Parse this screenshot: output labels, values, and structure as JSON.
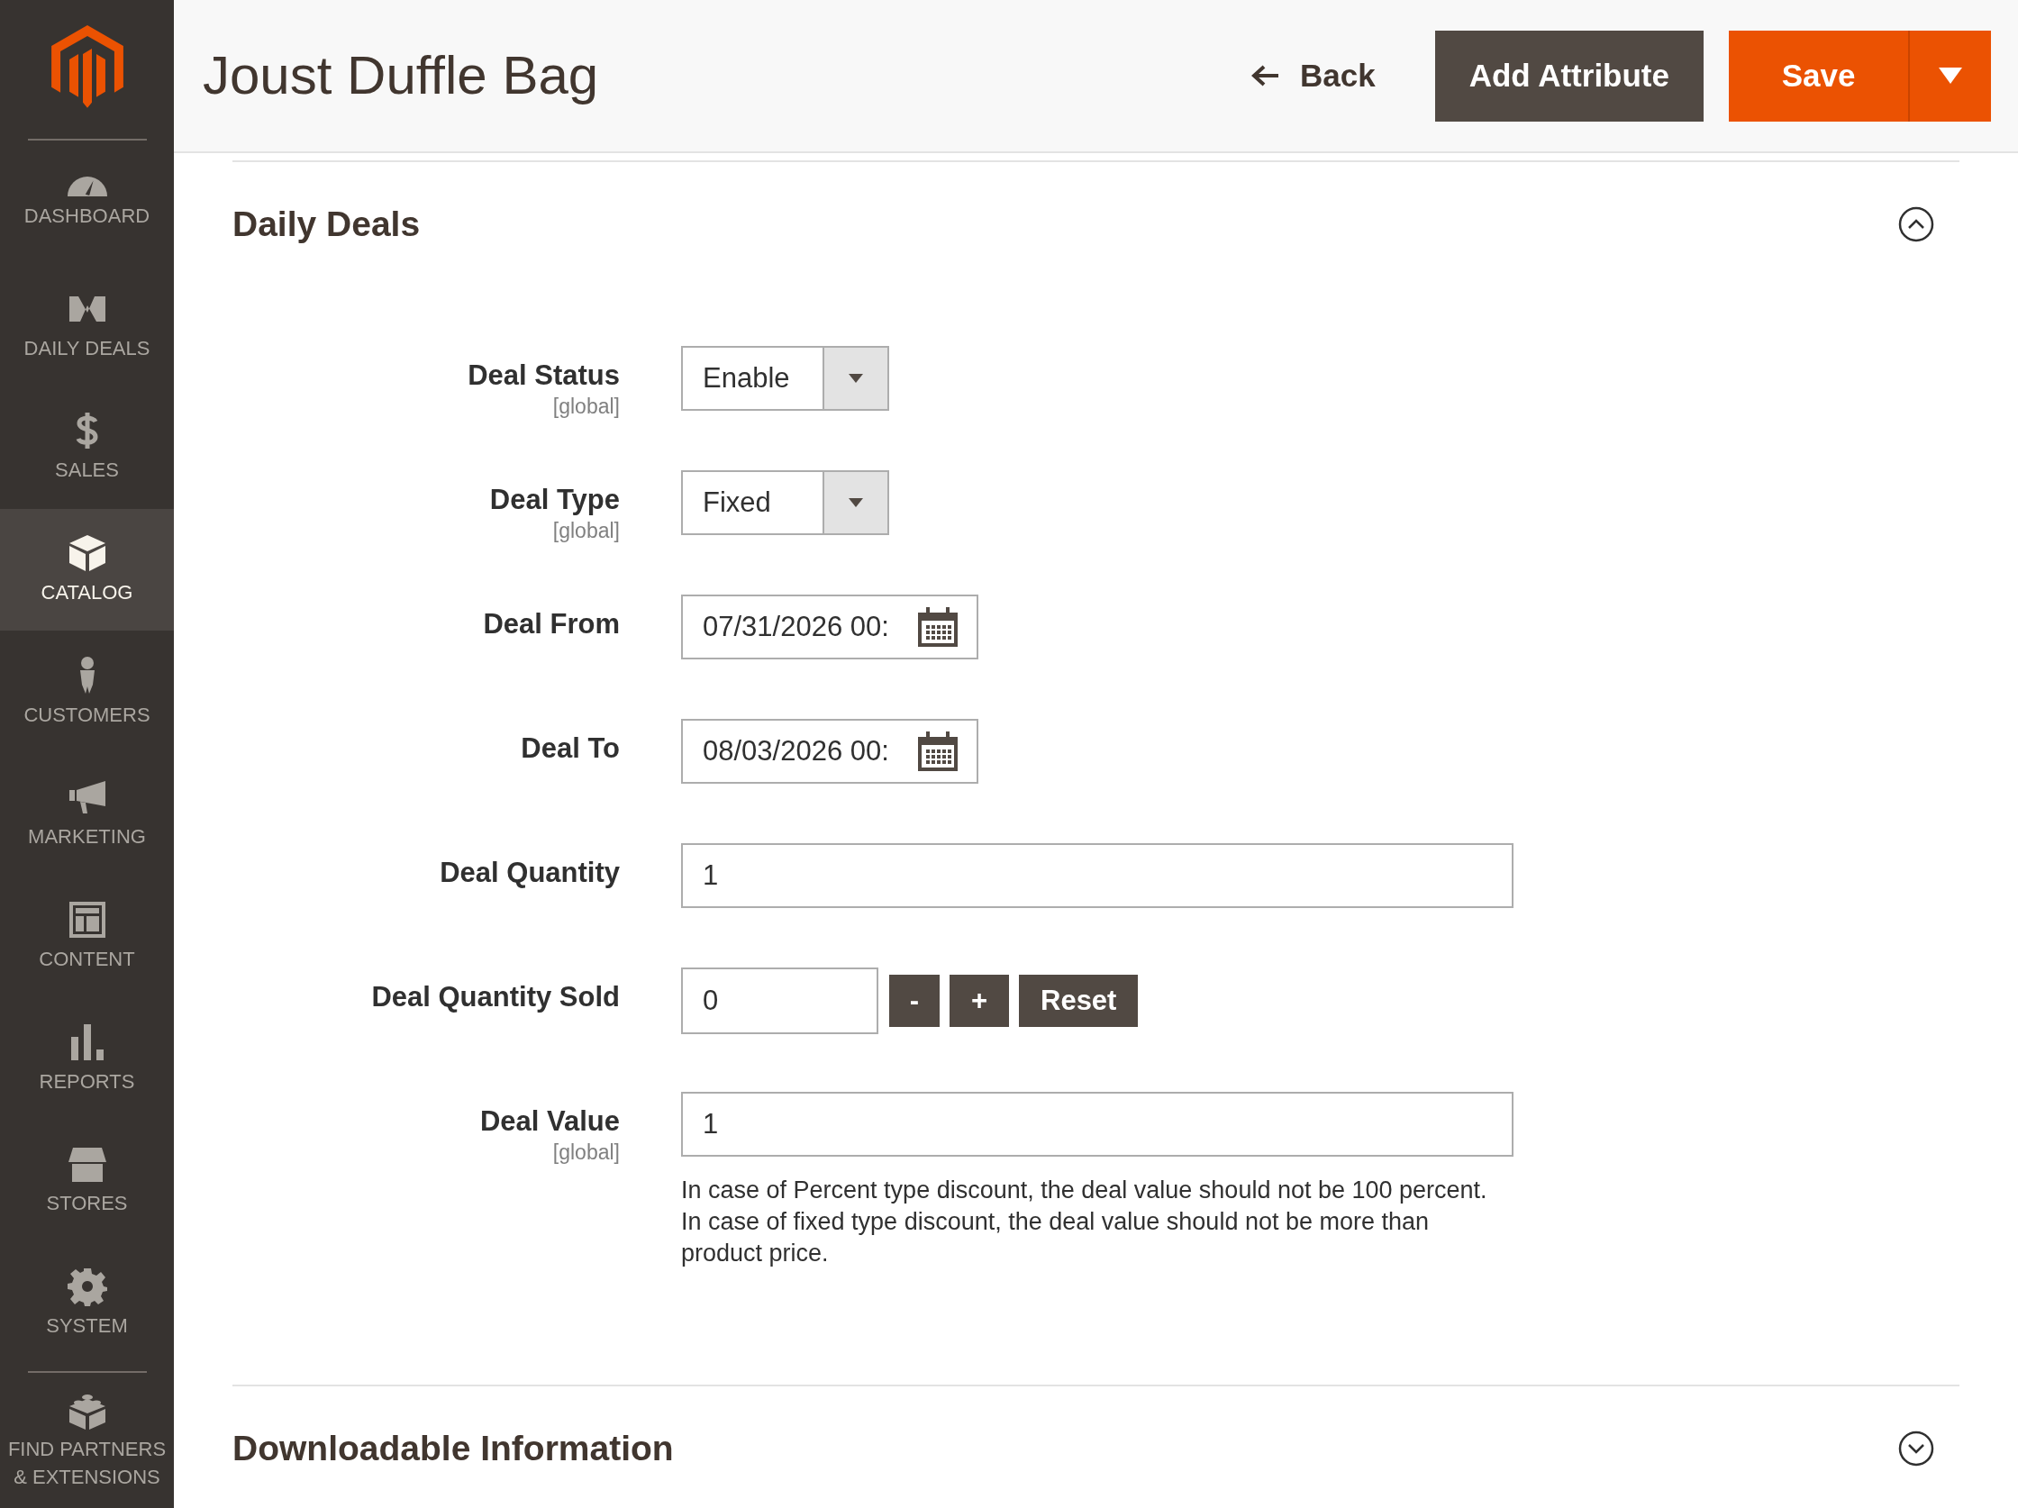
{
  "sidebar": {
    "items": [
      {
        "label": "DASHBOARD",
        "selected": false
      },
      {
        "label": "DAILY DEALS",
        "selected": false
      },
      {
        "label": "SALES",
        "selected": false
      },
      {
        "label": "CATALOG",
        "selected": true
      },
      {
        "label": "CUSTOMERS",
        "selected": false
      },
      {
        "label": "MARKETING",
        "selected": false
      },
      {
        "label": "CONTENT",
        "selected": false
      },
      {
        "label": "REPORTS",
        "selected": false
      },
      {
        "label": "STORES",
        "selected": false
      },
      {
        "label": "SYSTEM",
        "selected": false
      },
      {
        "label": "FIND PARTNERS & EXTENSIONS",
        "selected": false
      }
    ]
  },
  "header": {
    "title": "Joust Duffle Bag",
    "back": "Back",
    "add_attribute": "Add Attribute",
    "save": "Save"
  },
  "sections": [
    {
      "title": "Daily Deals",
      "expanded": true,
      "fields": [
        {
          "kind": "select",
          "label": "Deal Status",
          "scope": "[global]",
          "value": "Enable"
        },
        {
          "kind": "select",
          "label": "Deal Type",
          "scope": "[global]",
          "value": "Fixed"
        },
        {
          "kind": "date",
          "label": "Deal From",
          "value": "07/31/2026 00:"
        },
        {
          "kind": "date",
          "label": "Deal To",
          "value": "08/03/2026 00:"
        },
        {
          "kind": "text",
          "label": "Deal Quantity",
          "value": "1"
        },
        {
          "kind": "counter",
          "label": "Deal Quantity Sold",
          "value": "0",
          "buttons": [
            "-",
            "+",
            "Reset"
          ]
        },
        {
          "kind": "text",
          "label": "Deal Value",
          "scope": "[global]",
          "value": "1",
          "note": "In case of Percent type discount, the deal value should not be 100 percent. In case of fixed type discount, the deal value should not be more than product price."
        }
      ]
    },
    {
      "title": "Downloadable Information",
      "expanded": false
    }
  ]
}
